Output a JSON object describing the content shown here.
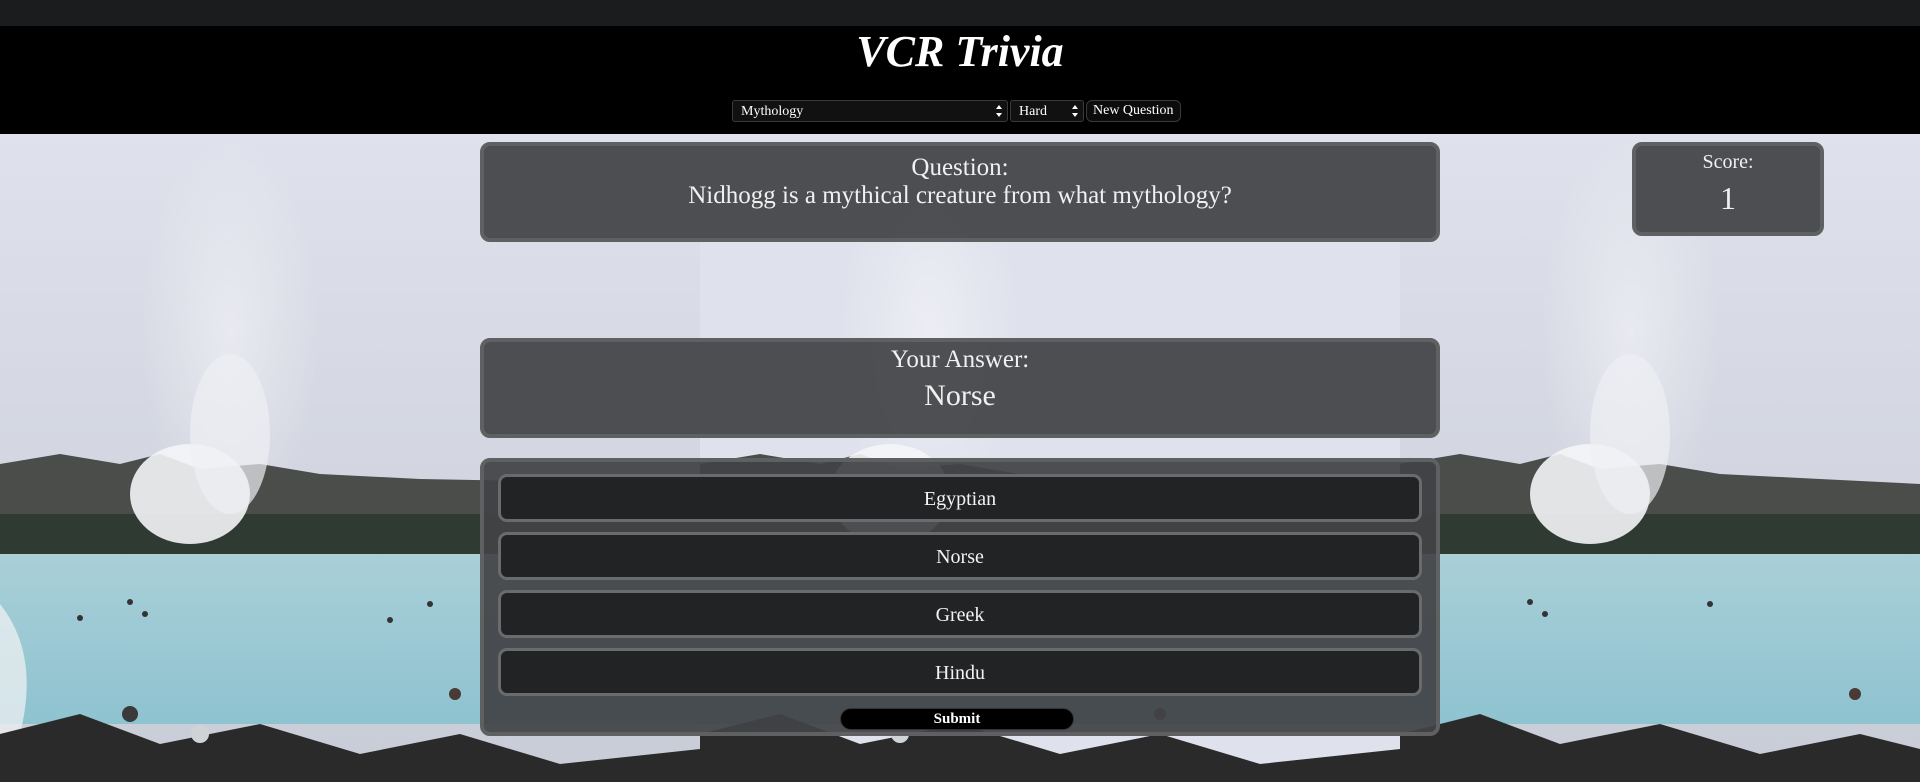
{
  "app": {
    "title": "VCR Trivia"
  },
  "controls": {
    "category": "Mythology",
    "difficulty": "Hard",
    "new_question_label": "New Question"
  },
  "question": {
    "label": "Question:",
    "text": "Nidhogg is a mythical creature from what mythology?"
  },
  "answer": {
    "label": "Your Answer:",
    "value": "Norse"
  },
  "score": {
    "label": "Score:",
    "value": "1"
  },
  "choices": [
    "Egyptian",
    "Norse",
    "Greek",
    "Hindu"
  ],
  "submit_label": "Submit",
  "colors": {
    "header_bg": "#000000",
    "panel_bg": "#424346",
    "panel_border": "#5f6062",
    "choice_bg": "#222325"
  },
  "icons": {
    "select_arrows": "updown-arrows-icon"
  }
}
